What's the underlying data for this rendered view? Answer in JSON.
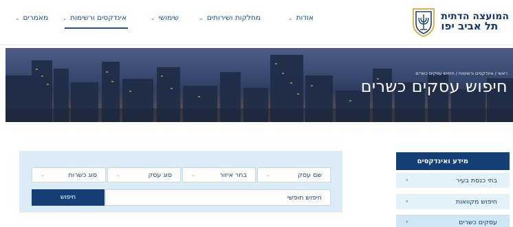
{
  "brand": {
    "line1": "המועצה הדתית",
    "line2": "תל אביב יפו",
    "emblem_icon": "menorah-shield-icon"
  },
  "nav": {
    "items": [
      {
        "label": "אודות",
        "dropdown": true
      },
      {
        "label": "מחלקות ושירותים",
        "dropdown": true
      },
      {
        "label": "שימושי",
        "dropdown": true
      },
      {
        "label": "אינדקסים ורשימות",
        "dropdown": true,
        "active": true
      },
      {
        "label": "מאמרים",
        "dropdown": true
      }
    ]
  },
  "hero": {
    "breadcrumb": "ראשי / אינדקסים ורשימות / חיפוש עסקים כשרים",
    "title": "חיפוש עסקים כשרים"
  },
  "sidebar": {
    "heading": "מידע ואינדקסים",
    "items": [
      {
        "label": "בתי כנסת בעיר"
      },
      {
        "label": "חיפוש מקוואות"
      },
      {
        "label": "עסקים כשרים",
        "current": true
      }
    ]
  },
  "search": {
    "fields": [
      {
        "label": "שם עסק"
      },
      {
        "label": "בחר איזור"
      },
      {
        "label": "סוג עסק"
      },
      {
        "label": "סוג כשרות"
      }
    ],
    "free_text_placeholder": "חיפוש חופשי",
    "button_label": "חיפוש"
  },
  "colors": {
    "primary": "#163f75",
    "panel_bg": "#dcecf6",
    "sidebar_item_bg": "#e3f1f9"
  }
}
